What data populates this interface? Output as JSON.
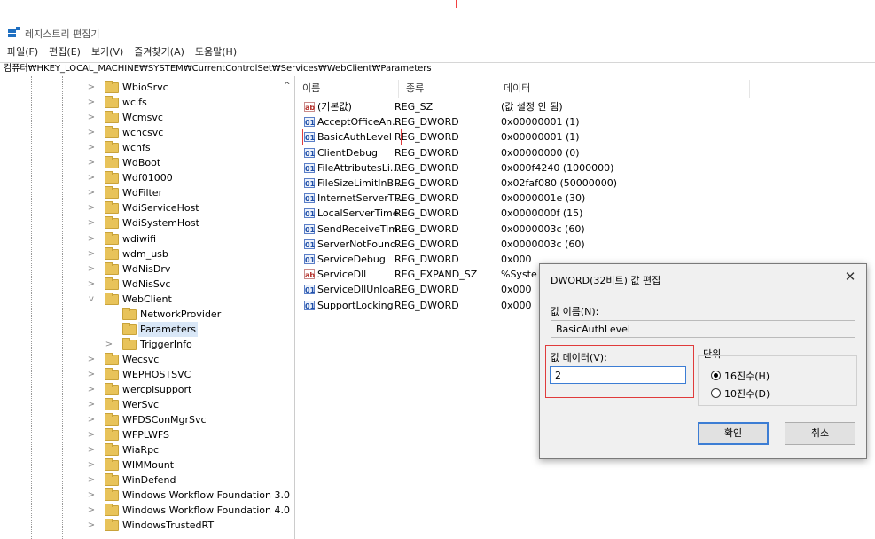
{
  "app": {
    "title": "레지스트리 편집기"
  },
  "menu": [
    "파일(F)",
    "편집(E)",
    "보기(V)",
    "즐겨찾기(A)",
    "도움말(H)"
  ],
  "address": "컴퓨터₩HKEY_LOCAL_MACHINE₩SYSTEM₩CurrentControlSet₩Services₩WebClient₩Parameters",
  "tree": [
    {
      "label": "WbioSrvc",
      "exp": ">"
    },
    {
      "label": "wcifs",
      "exp": ">"
    },
    {
      "label": "Wcmsvc",
      "exp": ">"
    },
    {
      "label": "wcncsvc",
      "exp": ">"
    },
    {
      "label": "wcnfs",
      "exp": ">"
    },
    {
      "label": "WdBoot",
      "exp": ">"
    },
    {
      "label": "Wdf01000",
      "exp": ">"
    },
    {
      "label": "WdFilter",
      "exp": ">"
    },
    {
      "label": "WdiServiceHost",
      "exp": ">"
    },
    {
      "label": "WdiSystemHost",
      "exp": ">"
    },
    {
      "label": "wdiwifi",
      "exp": ">"
    },
    {
      "label": "wdm_usb",
      "exp": ">"
    },
    {
      "label": "WdNisDrv",
      "exp": ">"
    },
    {
      "label": "WdNisSvc",
      "exp": ">"
    },
    {
      "label": "WebClient",
      "exp": "v"
    },
    {
      "label": "NetworkProvider",
      "exp": "",
      "child": true
    },
    {
      "label": "Parameters",
      "exp": "",
      "child": true,
      "selected": true
    },
    {
      "label": "TriggerInfo",
      "exp": ">",
      "child": true
    },
    {
      "label": "Wecsvc",
      "exp": ">"
    },
    {
      "label": "WEPHOSTSVC",
      "exp": ">"
    },
    {
      "label": "wercplsupport",
      "exp": ">"
    },
    {
      "label": "WerSvc",
      "exp": ">"
    },
    {
      "label": "WFDSConMgrSvc",
      "exp": ">"
    },
    {
      "label": "WFPLWFS",
      "exp": ">"
    },
    {
      "label": "WiaRpc",
      "exp": ">"
    },
    {
      "label": "WIMMount",
      "exp": ">"
    },
    {
      "label": "WinDefend",
      "exp": ">"
    },
    {
      "label": "Windows Workflow Foundation 3.0",
      "exp": ">"
    },
    {
      "label": "Windows Workflow Foundation 4.0",
      "exp": ">"
    },
    {
      "label": "WindowsTrustedRT",
      "exp": ">"
    }
  ],
  "columns": [
    "이름",
    "종류",
    "데이터"
  ],
  "values": [
    {
      "icon": "ab",
      "name": "(기본값)",
      "type": "REG_SZ",
      "data": "(값 설정 안 됨)"
    },
    {
      "icon": "bin",
      "name": "AcceptOfficeAn...",
      "type": "REG_DWORD",
      "data": "0x00000001 (1)"
    },
    {
      "icon": "bin",
      "name": "BasicAuthLevel",
      "type": "REG_DWORD",
      "data": "0x00000001 (1)",
      "highlight": true
    },
    {
      "icon": "bin",
      "name": "ClientDebug",
      "type": "REG_DWORD",
      "data": "0x00000000 (0)"
    },
    {
      "icon": "bin",
      "name": "FileAttributesLi...",
      "type": "REG_DWORD",
      "data": "0x000f4240 (1000000)"
    },
    {
      "icon": "bin",
      "name": "FileSizeLimitInB...",
      "type": "REG_DWORD",
      "data": "0x02faf080 (50000000)"
    },
    {
      "icon": "bin",
      "name": "InternetServerTi...",
      "type": "REG_DWORD",
      "data": "0x0000001e (30)"
    },
    {
      "icon": "bin",
      "name": "LocalServerTime...",
      "type": "REG_DWORD",
      "data": "0x0000000f (15)"
    },
    {
      "icon": "bin",
      "name": "SendReceiveTim...",
      "type": "REG_DWORD",
      "data": "0x0000003c (60)"
    },
    {
      "icon": "bin",
      "name": "ServerNotFound...",
      "type": "REG_DWORD",
      "data": "0x0000003c (60)"
    },
    {
      "icon": "bin",
      "name": "ServiceDebug",
      "type": "REG_DWORD",
      "data": "0x000"
    },
    {
      "icon": "ab",
      "name": "ServiceDll",
      "type": "REG_EXPAND_SZ",
      "data": "%Syste"
    },
    {
      "icon": "bin",
      "name": "ServiceDllUnloa...",
      "type": "REG_DWORD",
      "data": "0x000"
    },
    {
      "icon": "bin",
      "name": "SupportLocking",
      "type": "REG_DWORD",
      "data": "0x000"
    }
  ],
  "dialog": {
    "title": "DWORD(32비트) 값 편집",
    "value_name_label": "값 이름(N):",
    "value_name": "BasicAuthLevel",
    "value_data_label": "값 데이터(V):",
    "value_data": "2",
    "base_label": "단위",
    "hex_label": "16진수(H)",
    "dec_label": "10진수(D)",
    "ok_label": "확인",
    "cancel_label": "취소"
  },
  "colors": {
    "highlight": "#e03b3b",
    "accent": "#3c7dd4"
  }
}
